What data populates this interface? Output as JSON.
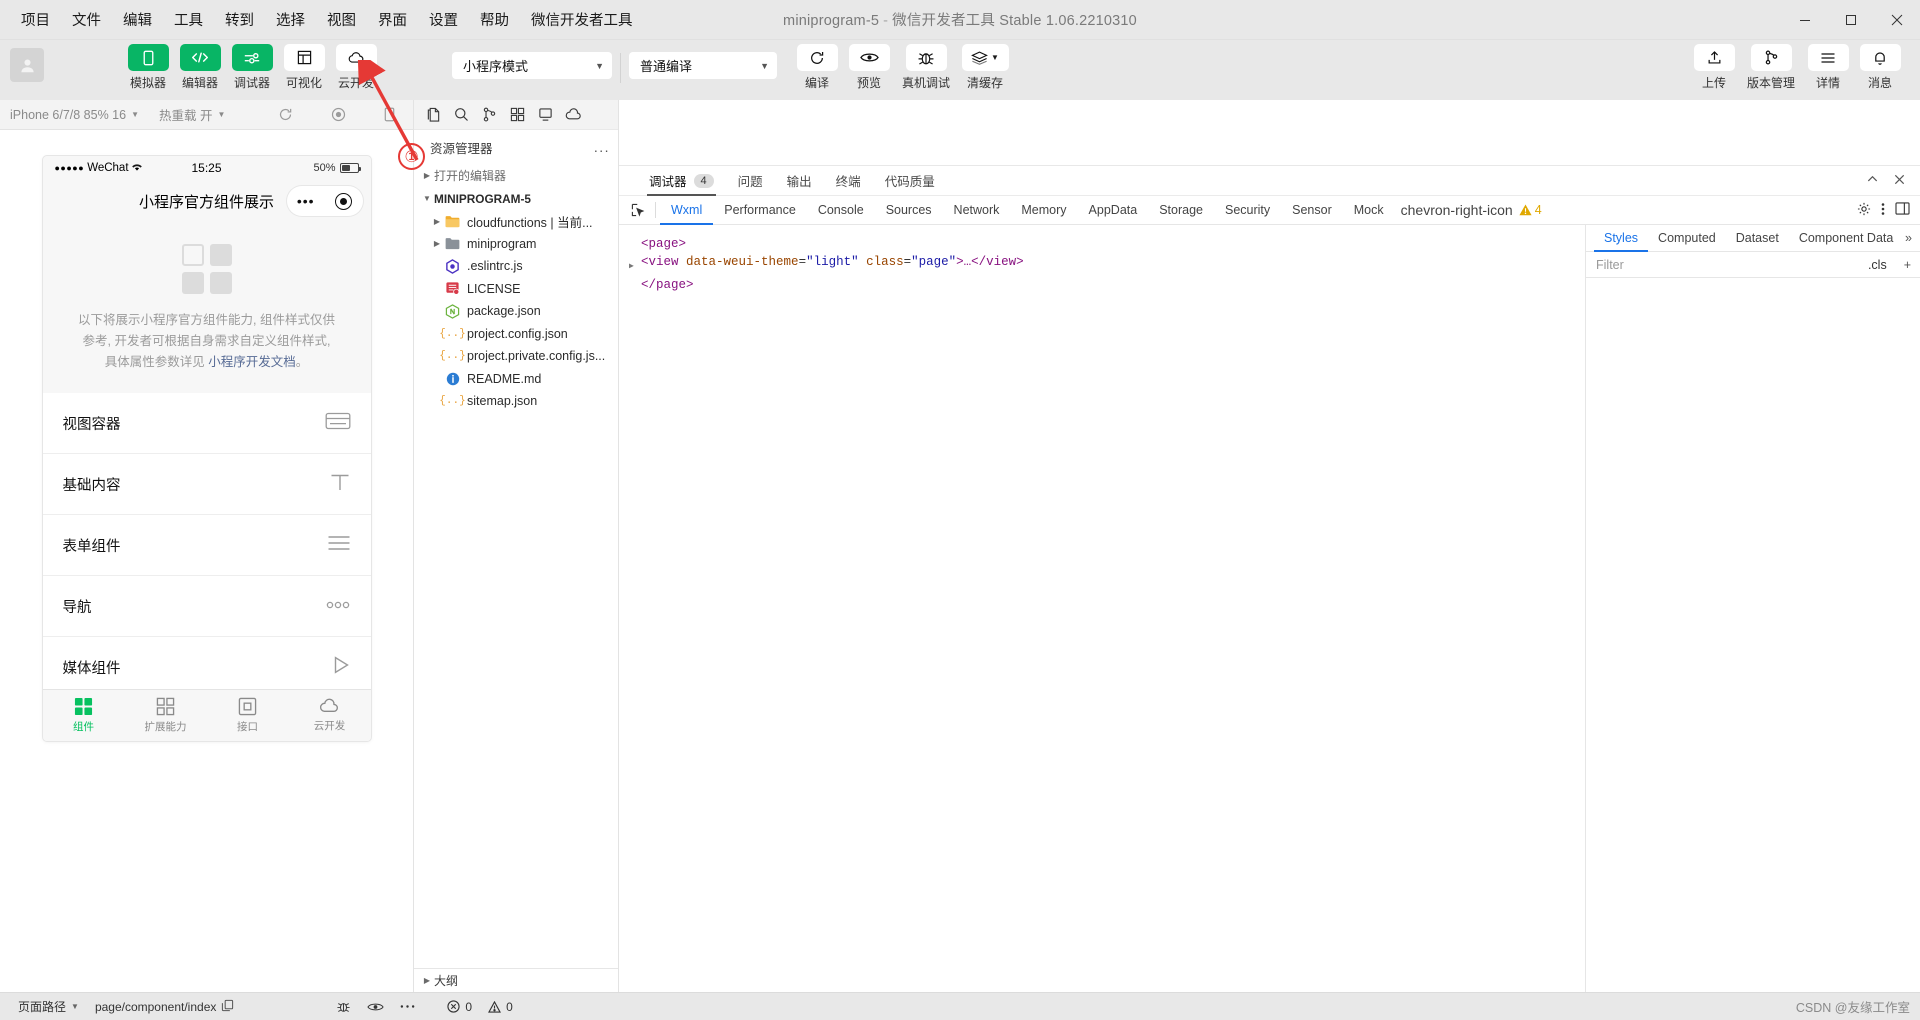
{
  "titlebar": {
    "menus": [
      "项目",
      "文件",
      "编辑",
      "工具",
      "转到",
      "选择",
      "视图",
      "界面",
      "设置",
      "帮助",
      "微信开发者工具"
    ],
    "title_project": "miniprogram-5",
    "title_sep": "-",
    "title_app": "微信开发者工具 Stable 1.06.2210310",
    "window_controls": [
      "minimize",
      "maximize",
      "close"
    ]
  },
  "toolbar": {
    "left_items": [
      {
        "label": "模拟器",
        "icon": "phone-icon",
        "active": true
      },
      {
        "label": "编辑器",
        "icon": "code-icon",
        "active": true
      },
      {
        "label": "调试器",
        "icon": "sliders-icon",
        "active": true
      },
      {
        "label": "可视化",
        "icon": "layout-icon",
        "active": false
      },
      {
        "label": "云开发",
        "icon": "cloud-icon",
        "active": false
      }
    ],
    "mode_select": "小程序模式",
    "compile_select": "普通编译",
    "center_items": [
      {
        "label": "编译",
        "icon": "refresh-icon"
      },
      {
        "label": "预览",
        "icon": "eye-icon"
      },
      {
        "label": "真机调试",
        "icon": "bug-icon"
      },
      {
        "label": "清缓存",
        "icon": "layers-icon"
      }
    ],
    "right_items": [
      {
        "label": "上传",
        "icon": "upload-icon"
      },
      {
        "label": "版本管理",
        "icon": "branch-icon"
      },
      {
        "label": "详情",
        "icon": "menu-icon"
      },
      {
        "label": "消息",
        "icon": "bell-icon"
      }
    ]
  },
  "simulator": {
    "device": "iPhone 6/7/8 85% 16",
    "hot_reload": "热重载 开",
    "icons": [
      "refresh-icon",
      "record-icon",
      "rotate-icon",
      "multi-screen-icon"
    ],
    "phone": {
      "carrier": "WeChat",
      "signal_dots": "●●●●●",
      "time": "15:25",
      "battery_pct": "50%",
      "nav_title": "小程序官方组件展示",
      "intro_line1": "以下将展示小程序官方组件能力, 组件样式仅供",
      "intro_line2": "参考, 开发者可根据自身需求自定义组件样式,",
      "intro_line3_prefix": "具体属性参数详见 ",
      "intro_link": "小程序开发文档",
      "intro_line3_suffix": "。",
      "list": [
        {
          "label": "视图容器",
          "icon": "view-container-icon"
        },
        {
          "label": "基础内容",
          "icon": "text-icon"
        },
        {
          "label": "表单组件",
          "icon": "form-icon"
        },
        {
          "label": "导航",
          "icon": "dots-icon"
        },
        {
          "label": "媒体组件",
          "icon": "play-icon"
        }
      ],
      "tabbar": [
        {
          "label": "组件",
          "icon": "component-icon",
          "active": true
        },
        {
          "label": "扩展能力",
          "icon": "extend-icon",
          "active": false
        },
        {
          "label": "接口",
          "icon": "api-icon",
          "active": false
        },
        {
          "label": "云开发",
          "icon": "cloud-tab-icon",
          "active": false
        }
      ]
    }
  },
  "explorer": {
    "toolbar_icons": [
      "new-file-icon",
      "search-icon",
      "source-control-icon",
      "extensions-icon",
      "debug-icon",
      "cloud-dev-icon"
    ],
    "title": "资源管理器",
    "overflow": "...",
    "open_editors": "打开的编辑器",
    "root": "MINIPROGRAM-5",
    "files": [
      {
        "name": "cloudfunctions | 当前...",
        "type": "folder",
        "color": "#f0ad2e",
        "expandable": true
      },
      {
        "name": "miniprogram",
        "type": "folder",
        "color": "#8a9199",
        "expandable": true
      },
      {
        "name": ".eslintrc.js",
        "type": "eslint",
        "color": "#4b32c3",
        "expandable": false
      },
      {
        "name": "LICENSE",
        "type": "license",
        "color": "#d73a49",
        "expandable": false
      },
      {
        "name": "package.json",
        "type": "npm",
        "color": "#6cb33f",
        "expandable": false
      },
      {
        "name": "project.config.json",
        "type": "json",
        "color": "#e8a33d",
        "expandable": false
      },
      {
        "name": "project.private.config.js...",
        "type": "json",
        "color": "#e8a33d",
        "expandable": false
      },
      {
        "name": "README.md",
        "type": "info",
        "color": "#2b7cd3",
        "expandable": false
      },
      {
        "name": "sitemap.json",
        "type": "json",
        "color": "#e8a33d",
        "expandable": false
      }
    ],
    "outline": "大纲"
  },
  "devtools": {
    "panel_tabs": [
      {
        "label": "调试器",
        "badge": "4",
        "active": true
      },
      {
        "label": "问题",
        "badge": "",
        "active": false
      },
      {
        "label": "输出",
        "badge": "",
        "active": false
      },
      {
        "label": "终端",
        "badge": "",
        "active": false
      },
      {
        "label": "代码质量",
        "badge": "",
        "active": false
      }
    ],
    "panel_actions": [
      "collapse-icon",
      "close-icon"
    ],
    "inspector_tabs": [
      "Wxml",
      "Performance",
      "Console",
      "Sources",
      "Network",
      "Memory",
      "AppData",
      "Storage",
      "Security",
      "Sensor",
      "Mock"
    ],
    "inspector_active": "Wxml",
    "overflow_icon": "chevron-right-icon",
    "warning_count": "4",
    "right_icons": [
      "gear-icon",
      "kebab-icon",
      "dock-icon"
    ],
    "dom": {
      "line1": "<page>",
      "line2_tag_open": "<view",
      "line2_attr1": "data-weui-theme",
      "line2_val1": "\"light\"",
      "line2_attr2": "class",
      "line2_val2": "\"page\"",
      "line2_mid": ">…</view>",
      "line3": "</page>"
    },
    "styles": {
      "tabs": [
        "Styles",
        "Computed",
        "Dataset",
        "Component Data"
      ],
      "active": "Styles",
      "more": "»",
      "filter_placeholder": "Filter",
      "cls": ".cls",
      "plus": "+"
    }
  },
  "statusbar": {
    "page_path_label": "页面路径",
    "page_path_value": "page/component/index",
    "copy_icon": "copy-icon",
    "icons": [
      "bug-status-icon",
      "eye-status-icon",
      "kebab-status-icon"
    ],
    "errors": "0",
    "warnings": "0",
    "watermark": "CSDN @友缘工作室"
  },
  "annotation": {
    "marker": "①",
    "color": "#e53935"
  }
}
